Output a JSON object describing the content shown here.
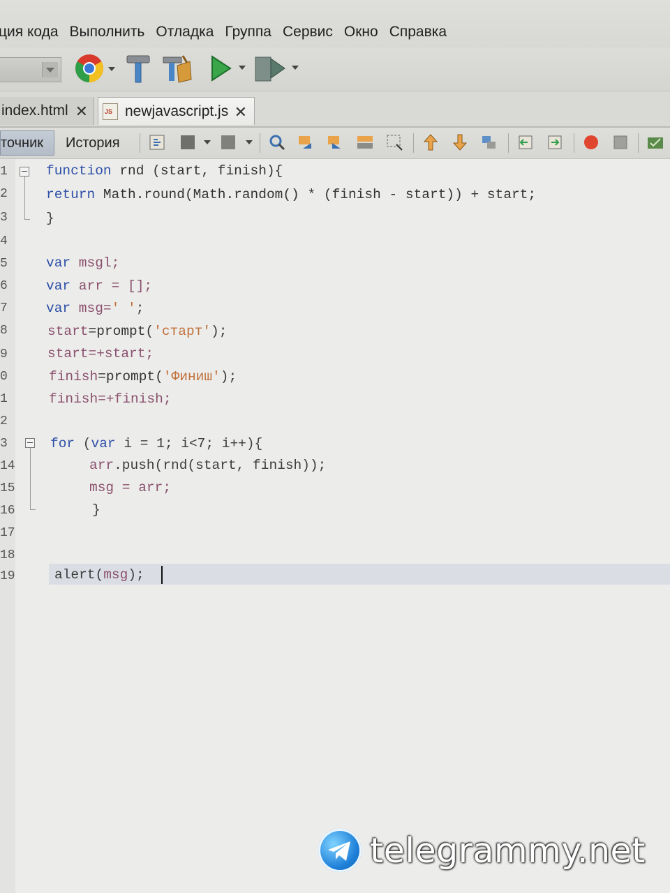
{
  "menu": {
    "items": [
      "ция кода",
      "Выполнить",
      "Отладка",
      "Группа",
      "Сервис",
      "Окно",
      "Справка"
    ]
  },
  "toolbar": {
    "icons": [
      "chrome-icon",
      "hammer-icon",
      "clean-build-icon",
      "run-icon",
      "debug-icon"
    ]
  },
  "tabs": [
    {
      "label": "index.html",
      "close": "✕",
      "active": false
    },
    {
      "label": "newjavascript.js",
      "close": "✕",
      "active": true
    }
  ],
  "editor_toolbar": {
    "source_label": "точник",
    "history_label": "История"
  },
  "editor": {
    "line_numbers": [
      "1",
      "2",
      "3",
      "4",
      "5",
      "6",
      "7",
      "8",
      "9",
      "0",
      "1",
      "2",
      "3",
      "14",
      "15",
      "16",
      "17",
      "18",
      "19"
    ],
    "current_line": 19
  },
  "code": {
    "l1": {
      "kw": "function",
      "rest": " rnd (start, finish){"
    },
    "l2": {
      "kw": "return",
      "a": " Math.round(Math.random() * (finish - start)) + start;"
    },
    "l3": "}",
    "l5": {
      "kw": "var",
      "rest": " msgl;"
    },
    "l6": {
      "kw": "var",
      "rest": " arr = [];"
    },
    "l7": {
      "kw": "var",
      "rest": " msg=",
      "str": "' '",
      "end": ";"
    },
    "l8": {
      "a": "start",
      "b": "=prompt(",
      "str": "'старт'",
      "end": ");"
    },
    "l9": {
      "a": "start",
      "b": "=+start;"
    },
    "l10": {
      "a": "finish",
      "b": "=prompt(",
      "str": "'Финиш'",
      "end": ");"
    },
    "l11": {
      "a": "finish",
      "b": "=+finish;"
    },
    "l13": {
      "kw": "for",
      "rest": " (",
      "kw2": "var",
      "rest2": " i = 1; i<7; i++){"
    },
    "l14": {
      "a": "arr",
      "b": ".push(rnd(start, finish));"
    },
    "l15": {
      "a": "msg",
      "b": " = arr;"
    },
    "l16": "}",
    "l19": {
      "a": "alert(",
      "b": "msg",
      "c": ");"
    }
  },
  "watermark": {
    "text": "telegrammy.net"
  }
}
